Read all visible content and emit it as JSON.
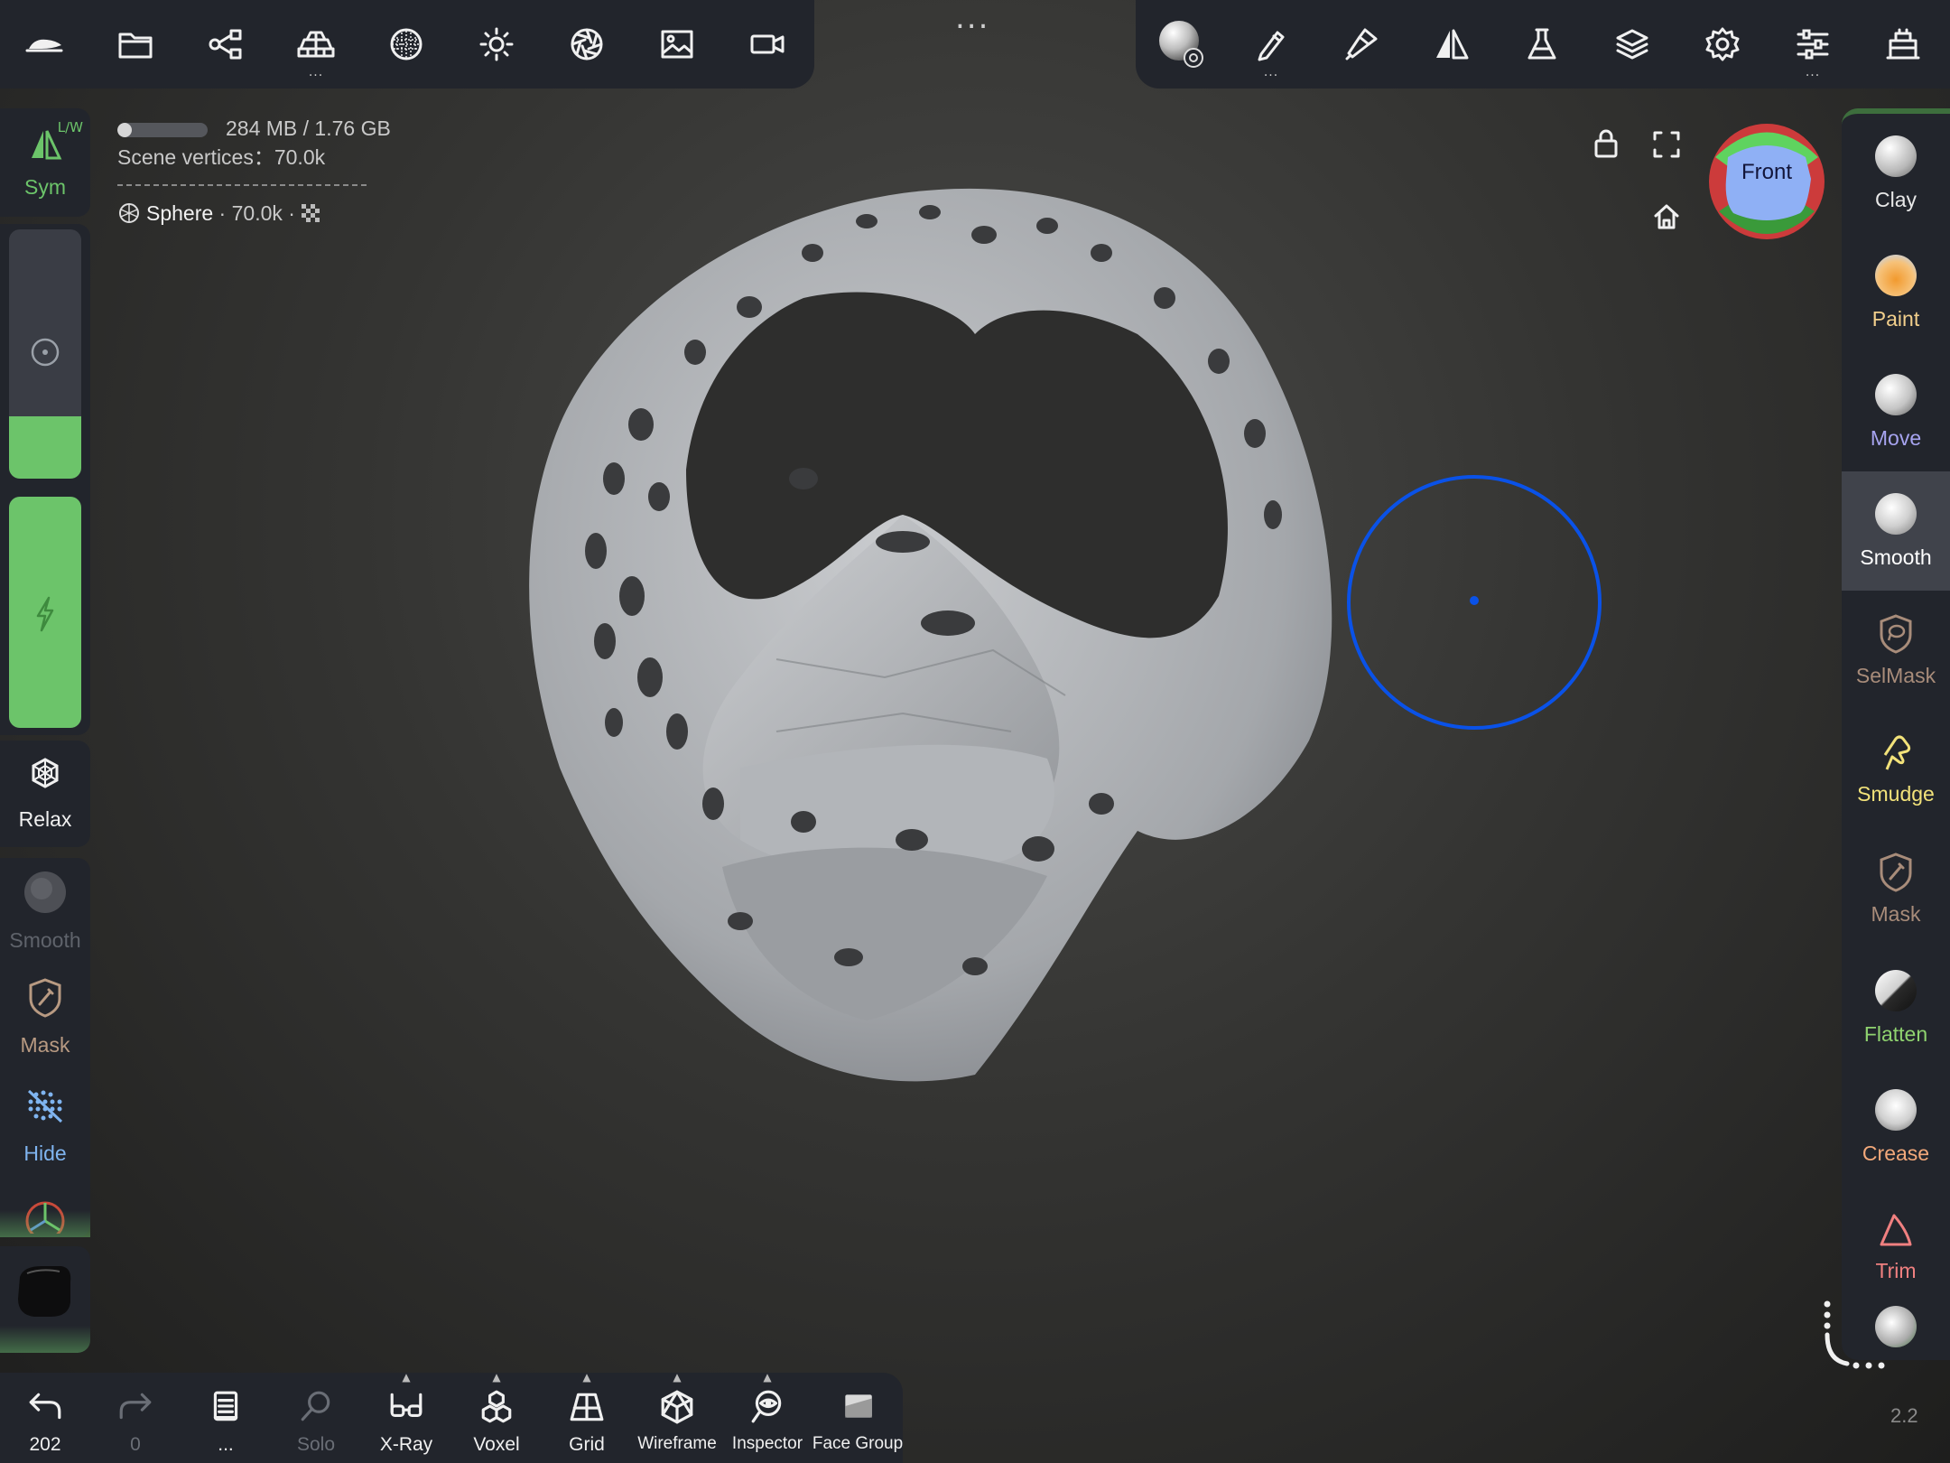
{
  "top_left_toolbar": {
    "items": [
      {
        "icon": "nomad-logo-icon"
      },
      {
        "icon": "folder-icon"
      },
      {
        "icon": "scene-graph-icon"
      },
      {
        "icon": "mesh-topology-icon"
      },
      {
        "icon": "material-sphere-icon"
      },
      {
        "icon": "light-sun-icon"
      },
      {
        "icon": "camera-aperture-icon"
      },
      {
        "icon": "background-image-icon"
      },
      {
        "icon": "video-camera-icon"
      }
    ],
    "more_dots": "..."
  },
  "top_right_toolbar": {
    "items": [
      {
        "icon": "smooth-brush-sphere-icon"
      },
      {
        "icon": "brush-stroke-icon"
      },
      {
        "icon": "painting-icon"
      },
      {
        "icon": "symmetry-icon"
      },
      {
        "icon": "flask-icon"
      },
      {
        "icon": "layers-icon"
      },
      {
        "icon": "settings-gear-icon"
      },
      {
        "icon": "sliders-icon"
      },
      {
        "icon": "gizmo-icon"
      }
    ],
    "small_dots": "..."
  },
  "viewport_info": {
    "memory_label": "284 MB / 1.76 GB",
    "memory_fraction": 0.16,
    "scene_vertices": "Scene vertices：70.0k",
    "object_name": "Sphere",
    "object_meta": " · 70.0k · "
  },
  "viewport_controls": {
    "lock_icon": "lock-icon",
    "fullscreen_icon": "fullscreen-icon",
    "home_icon": "home-icon",
    "view_cube_label": "Front"
  },
  "left_panel": {
    "sym_label": "Sym",
    "sym_badge": "L/W",
    "relax_label": "Relax",
    "smooth_label": "Smooth",
    "mask_label": "Mask",
    "hide_label": "Hide",
    "size_slider_fraction": 0.25,
    "intensity_slider_fraction": 1.0
  },
  "right_tools": [
    {
      "label": "Clay",
      "color": "#e8e8e8"
    },
    {
      "label": "Paint",
      "color": "#f2cf8c"
    },
    {
      "label": "Move",
      "color": "#a7a4f0"
    },
    {
      "label": "Smooth",
      "color": "#ffffff"
    },
    {
      "label": "SelMask",
      "color": "#a88c7a"
    },
    {
      "label": "Smudge",
      "color": "#f2e27a"
    },
    {
      "label": "Mask",
      "color": "#a88c7a"
    },
    {
      "label": "Flatten",
      "color": "#8fd36f"
    },
    {
      "label": "Crease",
      "color": "#f2a87a"
    },
    {
      "label": "Trim",
      "color": "#f08080"
    }
  ],
  "bottom_bar": [
    {
      "label": "202",
      "icon": "undo-icon",
      "dim": false
    },
    {
      "label": "0",
      "icon": "redo-icon",
      "dim": true
    },
    {
      "label": "...",
      "icon": "history-book-icon",
      "dim": false
    },
    {
      "label": "Solo",
      "icon": "solo-search-icon",
      "dim": true
    },
    {
      "label": "X-Ray",
      "icon": "xray-glasses-icon",
      "dim": false
    },
    {
      "label": "Voxel",
      "icon": "voxel-cubes-icon",
      "dim": false
    },
    {
      "label": "Grid",
      "icon": "grid-plane-icon",
      "dim": false
    },
    {
      "label": "Wireframe",
      "icon": "wireframe-icon",
      "dim": false
    },
    {
      "label": "Inspector",
      "icon": "inspector-eye-icon",
      "dim": false
    },
    {
      "label": "Face Group",
      "icon": "face-group-icon",
      "dim": false
    }
  ],
  "version": "2.2",
  "accent_color": "#6cc46a",
  "brush_circle_color": "#0a52e8"
}
